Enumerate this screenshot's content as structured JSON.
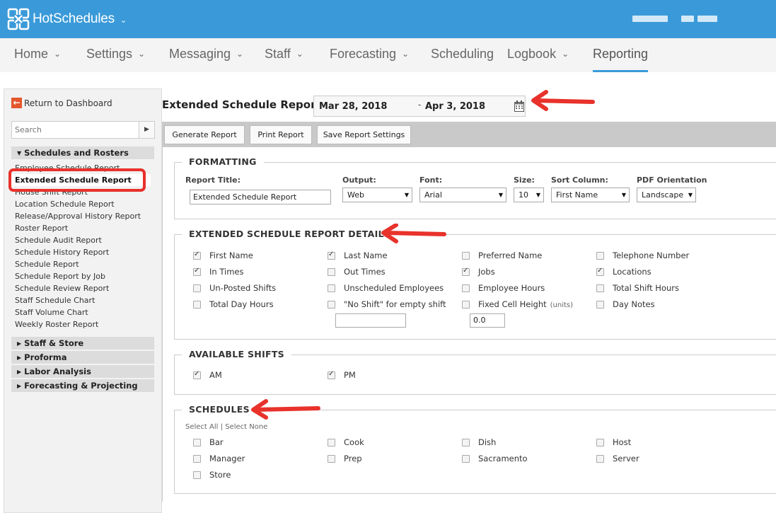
{
  "app": {
    "brand": "HotSchedules"
  },
  "nav": {
    "items": [
      {
        "label": "Home",
        "has_menu": true
      },
      {
        "label": "Settings",
        "has_menu": true
      },
      {
        "label": "Messaging",
        "has_menu": true
      },
      {
        "label": "Staff",
        "has_menu": true
      },
      {
        "label": "Forecasting",
        "has_menu": true
      },
      {
        "label": "Scheduling",
        "has_menu": false
      },
      {
        "label": "Logbook",
        "has_menu": true
      },
      {
        "label": "Reporting",
        "has_menu": false,
        "active": true
      }
    ]
  },
  "sidebar": {
    "return_label": "Return to Dashboard",
    "search_placeholder": "Search",
    "groups": [
      {
        "label": "Schedules and Rosters",
        "expanded": true
      },
      {
        "label": "Staff & Store",
        "expanded": false
      },
      {
        "label": "Proforma",
        "expanded": false
      },
      {
        "label": "Labor Analysis",
        "expanded": false
      },
      {
        "label": "Forecasting & Projecting",
        "expanded": false
      }
    ],
    "reports": [
      "Employee Schedule Report",
      "Extended Schedule Report",
      "House Shift Report",
      "Location Schedule Report",
      "Release/Approval History Report",
      "Roster Report",
      "Schedule Audit Report",
      "Schedule History Report",
      "Schedule Report",
      "Schedule Report by Job",
      "Schedule Review Report",
      "Staff Schedule Chart",
      "Staff Volume Chart",
      "Weekly Roster Report"
    ],
    "selected_report": "Extended Schedule Report"
  },
  "header": {
    "title": "Extended Schedule Report",
    "date_start": "Mar 28, 2018",
    "date_separator": "-",
    "date_end": "Apr 3, 2018"
  },
  "toolbar": {
    "generate": "Generate Report",
    "print": "Print Report",
    "save": "Save Report Settings"
  },
  "formatting": {
    "legend": "FORMATTING",
    "report_title_label": "Report Title:",
    "report_title_value": "Extended Schedule Report",
    "output_label": "Output:",
    "output_value": "Web",
    "font_label": "Font:",
    "font_value": "Arial",
    "size_label": "Size:",
    "size_value": "10",
    "sort_label": "Sort Column:",
    "sort_value": "First Name",
    "orientation_label": "PDF Orientation",
    "orientation_value": "Landscape"
  },
  "details": {
    "legend": "EXTENDED SCHEDULE REPORT DETAILS",
    "options": [
      {
        "label": "First Name",
        "checked": true
      },
      {
        "label": "Last Name",
        "checked": true
      },
      {
        "label": "Preferred Name",
        "checked": false
      },
      {
        "label": "Telephone Number",
        "checked": false
      },
      {
        "label": "In Times",
        "checked": true
      },
      {
        "label": "Out Times",
        "checked": false
      },
      {
        "label": "Jobs",
        "checked": true
      },
      {
        "label": "Locations",
        "checked": true
      },
      {
        "label": "Un-Posted Shifts",
        "checked": false
      },
      {
        "label": "Unscheduled Employees",
        "checked": false
      },
      {
        "label": "Employee Hours",
        "checked": false
      },
      {
        "label": "Total Shift Hours",
        "checked": false
      },
      {
        "label": "Total Day Hours",
        "checked": false
      },
      {
        "label": "\"No Shift\" for empty shift",
        "checked": false
      },
      {
        "label": "Fixed Cell Height",
        "checked": false
      },
      {
        "label": "Day Notes",
        "checked": false
      }
    ],
    "units_label": "(units)",
    "no_shift_text": "",
    "cell_height_value": "0.0"
  },
  "shifts": {
    "legend": "AVAILABLE SHIFTS",
    "options": [
      {
        "label": "AM",
        "checked": true
      },
      {
        "label": "PM",
        "checked": true
      }
    ]
  },
  "schedules": {
    "legend": "SCHEDULES",
    "select_all": "Select All",
    "separator": "|",
    "select_none": "Select None",
    "options": [
      {
        "label": "Bar",
        "checked": false
      },
      {
        "label": "Cook",
        "checked": false
      },
      {
        "label": "Dish",
        "checked": false
      },
      {
        "label": "Host",
        "checked": false
      },
      {
        "label": "Manager",
        "checked": false
      },
      {
        "label": "Prep",
        "checked": false
      },
      {
        "label": "Sacramento",
        "checked": false
      },
      {
        "label": "Server",
        "checked": false
      },
      {
        "label": "Store",
        "checked": false
      }
    ]
  },
  "colors": {
    "brand_blue": "#3a9ad9",
    "annotation_red": "#e8322b"
  }
}
